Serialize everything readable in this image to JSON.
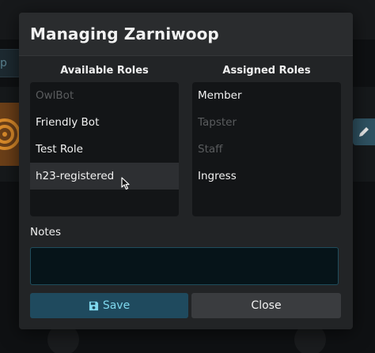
{
  "background": {
    "search_fragment": "p"
  },
  "modal": {
    "title": "Managing Zarniwoop"
  },
  "available_roles": {
    "title": "Available Roles",
    "items": [
      {
        "label": "OwlBot",
        "disabled": true
      },
      {
        "label": "Friendly Bot",
        "disabled": false
      },
      {
        "label": "Test Role",
        "disabled": false
      },
      {
        "label": "h23-registered",
        "disabled": false,
        "hovered": true
      }
    ]
  },
  "assigned_roles": {
    "title": "Assigned Roles",
    "items": [
      {
        "label": "Member",
        "disabled": false
      },
      {
        "label": "Tapster",
        "disabled": true
      },
      {
        "label": "Staff",
        "disabled": true
      },
      {
        "label": "Ingress",
        "disabled": false
      }
    ]
  },
  "notes": {
    "label": "Notes",
    "value": ""
  },
  "buttons": {
    "save_label": "Save",
    "save_icon": "floppy-disk-icon",
    "close_label": "Close"
  },
  "colors": {
    "accent": "#7fd8ee",
    "save_bg": "#1f4a5e",
    "modal_bg": "#222426",
    "list_bg": "#131517",
    "disabled_text": "#5a5c5e"
  }
}
